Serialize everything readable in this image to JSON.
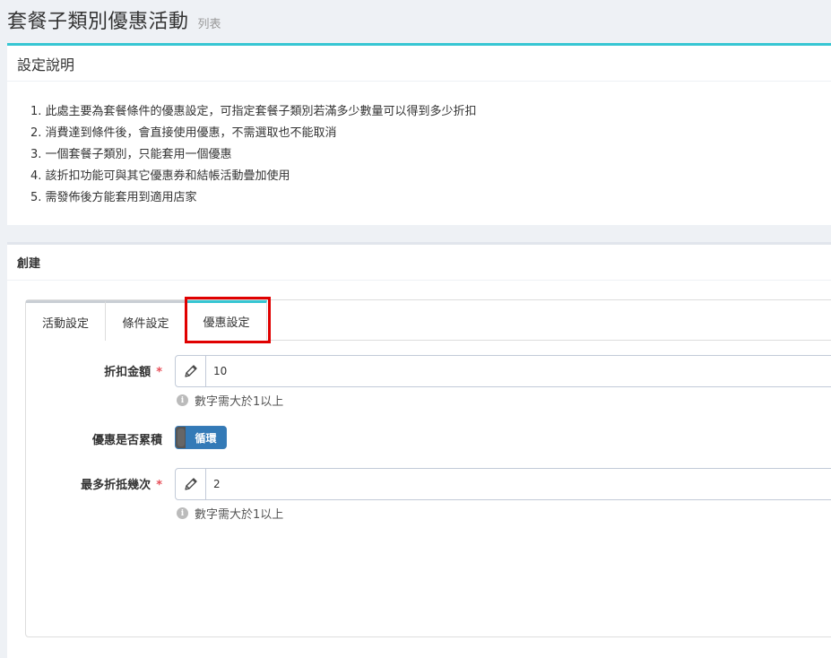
{
  "header": {
    "title": "套餐子類別優惠活動",
    "subtitle": "列表"
  },
  "description": {
    "title": "設定說明",
    "items": [
      "1. 此處主要為套餐條件的優惠設定，可指定套餐子類別若滿多少數量可以得到多少折扣",
      "2. 消費達到條件後，會直接使用優惠，不需選取也不能取消",
      "3. 一個套餐子類別，只能套用一個優惠",
      "4. 該折扣功能可與其它優惠券和結帳活動疊加使用",
      "5. 需發佈後方能套用到適用店家"
    ]
  },
  "create": {
    "title": "創建",
    "tabs": [
      {
        "label": "活動設定"
      },
      {
        "label": "條件設定"
      },
      {
        "label": "優惠設定"
      }
    ],
    "active_tab": "優惠設定",
    "form": {
      "discount_amount": {
        "label": "折扣金額",
        "required": "*",
        "value": "10",
        "help": "數字需大於1以上"
      },
      "cumulative": {
        "label": "優惠是否累積",
        "toggle_label": "循環",
        "state": "on"
      },
      "max_times": {
        "label": "最多折抵幾次",
        "required": "*",
        "value": "2",
        "help": "數字需大於1以上"
      }
    },
    "info_icon_glyph": "i"
  },
  "colors": {
    "accent": "#36c6d3",
    "highlight": "#e00000",
    "toggle_on": "#337ab7",
    "required": "#e7505a"
  }
}
